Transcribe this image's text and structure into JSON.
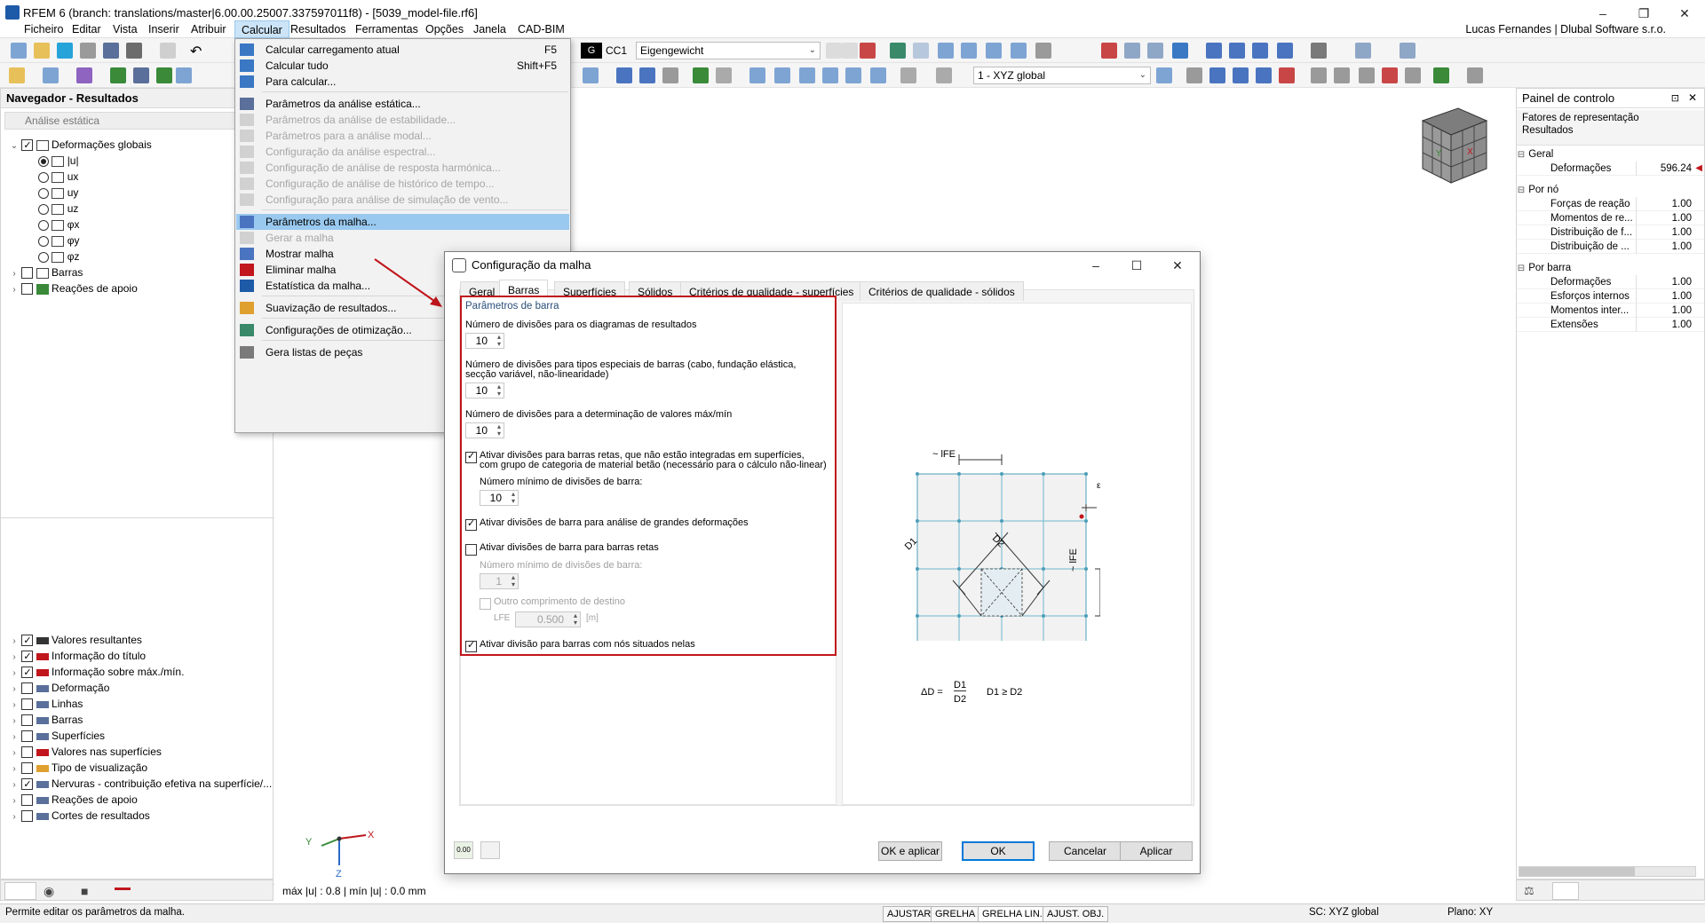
{
  "window": {
    "title": "RFEM 6 (branch: translations/master|6.00.00.25007.337597011f8) - [5039_model-file.rf6]",
    "user": "Lucas Fernandes | Dlubal Software s.r.o."
  },
  "menu": [
    "Ficheiro",
    "Editar",
    "Vista",
    "Inserir",
    "Atribuir",
    "Calcular",
    "Resultados",
    "Ferramentas",
    "Opções",
    "Janela",
    "CAD-BIM"
  ],
  "toolbar": {
    "load_case_code": "G",
    "load_case": "CC1",
    "load_case_name": "Eigengewicht",
    "view_combo": "1 - XYZ global"
  },
  "navigator": {
    "title": "Navegador - Resultados",
    "analysis": "Análise estática",
    "tree": {
      "global_deformations": "Deformações globais",
      "options": [
        "|u|",
        "ux",
        "uy",
        "uz",
        "φx",
        "φy",
        "φz"
      ],
      "bars": "Barras",
      "supports": "Reações de apoio"
    },
    "bottom": [
      "Valores resultantes",
      "Informação do título",
      "Informação sobre máx./mín.",
      "Deformação",
      "Linhas",
      "Barras",
      "Superfícies",
      "Valores nas superfícies",
      "Tipo de visualização",
      "Nervuras - contribuição efetiva na superfície/...",
      "Reações de apoio",
      "Cortes de resultados"
    ],
    "bottom_checked": [
      true,
      true,
      true,
      false,
      false,
      false,
      false,
      false,
      false,
      true,
      false,
      false
    ]
  },
  "calc_menu": {
    "items": [
      {
        "label": "Calcular carregamento atual",
        "shortcut": "F5",
        "disabled": false
      },
      {
        "label": "Calcular tudo",
        "shortcut": "Shift+F5",
        "disabled": false
      },
      {
        "label": "Para calcular...",
        "shortcut": "",
        "disabled": false
      },
      {
        "label": "Parâmetros da análise estática...",
        "shortcut": "",
        "disabled": false
      },
      {
        "label": "Parâmetros da análise de estabilidade...",
        "shortcut": "",
        "disabled": true
      },
      {
        "label": "Parâmetros para a análise modal...",
        "shortcut": "",
        "disabled": true
      },
      {
        "label": "Configuração da análise espectral...",
        "shortcut": "",
        "disabled": true
      },
      {
        "label": "Configuração de análise de resposta harmónica...",
        "shortcut": "",
        "disabled": true
      },
      {
        "label": "Configuração de análise de histórico de tempo...",
        "shortcut": "",
        "disabled": true
      },
      {
        "label": "Configuração para análise de simulação de vento...",
        "shortcut": "",
        "disabled": true
      },
      {
        "label": "Parâmetros da malha...",
        "shortcut": "",
        "disabled": false
      },
      {
        "label": "Gerar a malha",
        "shortcut": "",
        "disabled": true
      },
      {
        "label": "Mostrar malha",
        "shortcut": "",
        "disabled": false
      },
      {
        "label": "Eliminar malha",
        "shortcut": "",
        "disabled": false
      },
      {
        "label": "Estatística da malha...",
        "shortcut": "",
        "disabled": false
      },
      {
        "label": "Suavização de resultados...",
        "shortcut": "",
        "disabled": false
      },
      {
        "label": "Configurações de otimização...",
        "shortcut": "",
        "disabled": false
      },
      {
        "label": "Gera listas de peças",
        "shortcut": "",
        "disabled": false
      }
    ]
  },
  "dialog": {
    "title": "Configuração da malha",
    "tabs": [
      "Geral",
      "Barras",
      "Superfícies",
      "Sólidos",
      "Critérios de qualidade - superfícies",
      "Critérios de qualidade - sólidos"
    ],
    "group_title": "Parâmetros de barra",
    "div_results_label": "Número de divisões para os diagramas de resultados",
    "div_results_value": "10",
    "div_special_label1": "Número de divisões para tipos especiais de barras (cabo, fundação elástica,",
    "div_special_label2": "secção variável, não-linearidade)",
    "div_special_value": "10",
    "div_maxmin_label": "Número de divisões para a determinação de valores máx/mín",
    "div_maxmin_value": "10",
    "cb_straight_label1": "Ativar divisões para barras retas, que não estão integradas em superfícies,",
    "cb_straight_label2": "com grupo de categoria de material betão (necessário para o cálculo não-linear)",
    "min_div_label": "Número mínimo de divisões de barra:",
    "min_div_value": "10",
    "cb_large_def_label": "Ativar divisões de barra para análise de grandes deformações",
    "cb_straight2_label": "Ativar divisões de barra para barras retas",
    "min_div2_label": "Número mínimo de divisões de barra:",
    "min_div2_value": "1",
    "other_length_label": "Outro comprimento de destino",
    "lfe_label": "LFE",
    "lfe_value": "0.500",
    "lfe_unit": "[m]",
    "cb_nodes_label": "Ativar divisão para barras com nós situados nelas",
    "fig_lfe_top": "~ lFE",
    "fig_lfe_side": "~ lFE",
    "fig_eps": "ε",
    "fig_d1": "D1",
    "fig_d2": "D2",
    "formula_left": "ΔD =",
    "formula_num": "D1",
    "formula_den": "D2",
    "formula_right": "D1 ≥ D2",
    "buttons": {
      "ok_apply": "OK e aplicar",
      "ok": "OK",
      "cancel": "Cancelar",
      "apply": "Aplicar"
    },
    "footer_icon_label": "0.00"
  },
  "control_panel": {
    "title": "Painel de controlo",
    "subtitle1": "Fatores de representação",
    "subtitle2": "Resultados",
    "groups": [
      {
        "name": "Geral",
        "rows": [
          {
            "label": "Deformações",
            "value": "596.24"
          }
        ]
      },
      {
        "name": "Por nó",
        "rows": [
          {
            "label": "Forças de reação",
            "value": "1.00"
          },
          {
            "label": "Momentos de re...",
            "value": "1.00"
          },
          {
            "label": "Distribuição de f...",
            "value": "1.00"
          },
          {
            "label": "Distribuição de ...",
            "value": "1.00"
          }
        ]
      },
      {
        "name": "Por barra",
        "rows": [
          {
            "label": "Deformações",
            "value": "1.00"
          },
          {
            "label": "Esforços internos",
            "value": "1.00"
          },
          {
            "label": "Momentos inter...",
            "value": "1.00"
          },
          {
            "label": "Extensões",
            "value": "1.00"
          }
        ]
      }
    ]
  },
  "viewport": {
    "maxmin": "máx |u| : 0.8 | mín |u| : 0.0 mm",
    "axis_x": "X",
    "axis_y": "Y",
    "axis_z": "Z"
  },
  "status": {
    "hint": "Permite editar os parâmetros da malha.",
    "buttons": [
      "AJUSTAR",
      "GRELHA",
      "GRELHA LIN.",
      "AJUST. OBJ."
    ],
    "cs": "SC: XYZ global",
    "plane": "Plano: XY"
  },
  "colors": {
    "highlight_red": "#c0161c",
    "accent_blue": "#0078d7",
    "menu_hl": "#99c9ef"
  }
}
